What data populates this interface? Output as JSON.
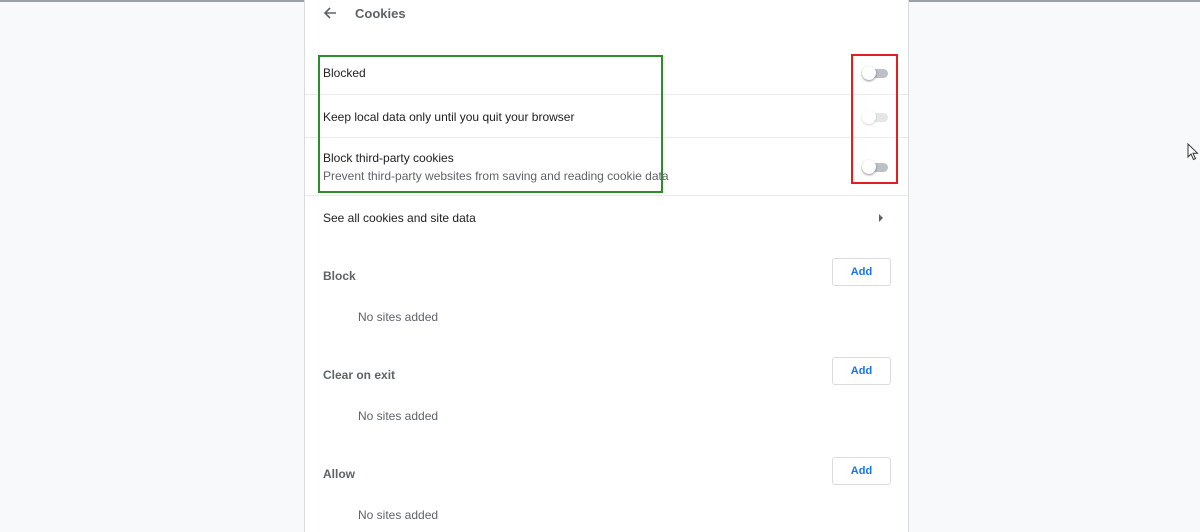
{
  "header": {
    "back_icon": "arrow-left-icon",
    "title": "Cookies"
  },
  "toggles": [
    {
      "label": "Blocked",
      "sublabel": "",
      "enabled": false,
      "disabled": false
    },
    {
      "label": "Keep local data only until you quit your browser",
      "sublabel": "",
      "enabled": false,
      "disabled": true
    },
    {
      "label": "Block third-party cookies",
      "sublabel": "Prevent third-party websites from saving and reading cookie data",
      "enabled": false,
      "disabled": false
    }
  ],
  "see_all": {
    "label": "See all cookies and site data",
    "icon": "chevron-right-icon"
  },
  "sections": [
    {
      "title": "Block",
      "button_label": "Add",
      "empty_text": "No sites added"
    },
    {
      "title": "Clear on exit",
      "button_label": "Add",
      "empty_text": "No sites added"
    },
    {
      "title": "Allow",
      "button_label": "Add",
      "empty_text": "No sites added"
    }
  ],
  "colors": {
    "accent": "#1a73e8",
    "highlight_green": "#2e8b2e",
    "highlight_red": "#e02020"
  }
}
